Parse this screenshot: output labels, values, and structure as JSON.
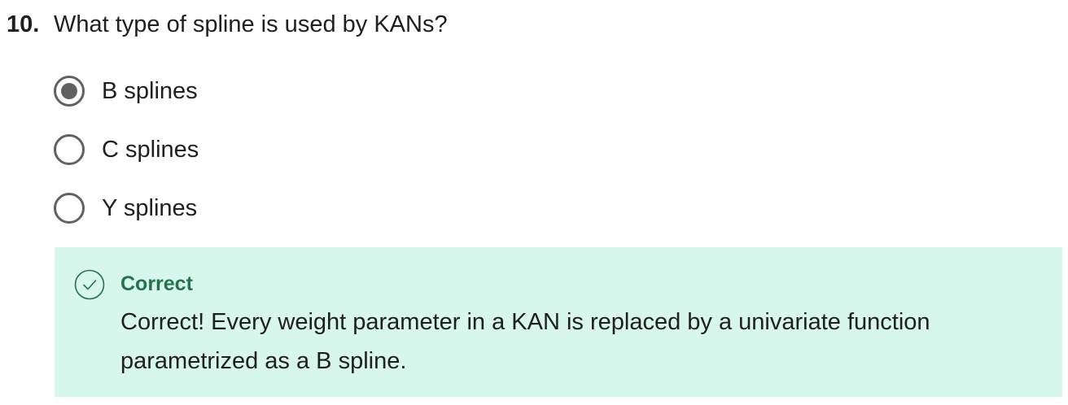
{
  "question": {
    "number": "10.",
    "text": "What type of spline is used by KANs?"
  },
  "options": [
    {
      "label": "B splines",
      "selected": true
    },
    {
      "label": "C splines",
      "selected": false
    },
    {
      "label": "Y splines",
      "selected": false
    }
  ],
  "feedback": {
    "status": "Correct",
    "message": "Correct! Every weight parameter in a KAN is replaced by a univariate function parametrized as a B spline.",
    "icon": "check-circle-icon",
    "background_color": "#d7f6ec",
    "accent_color": "#24724f"
  }
}
